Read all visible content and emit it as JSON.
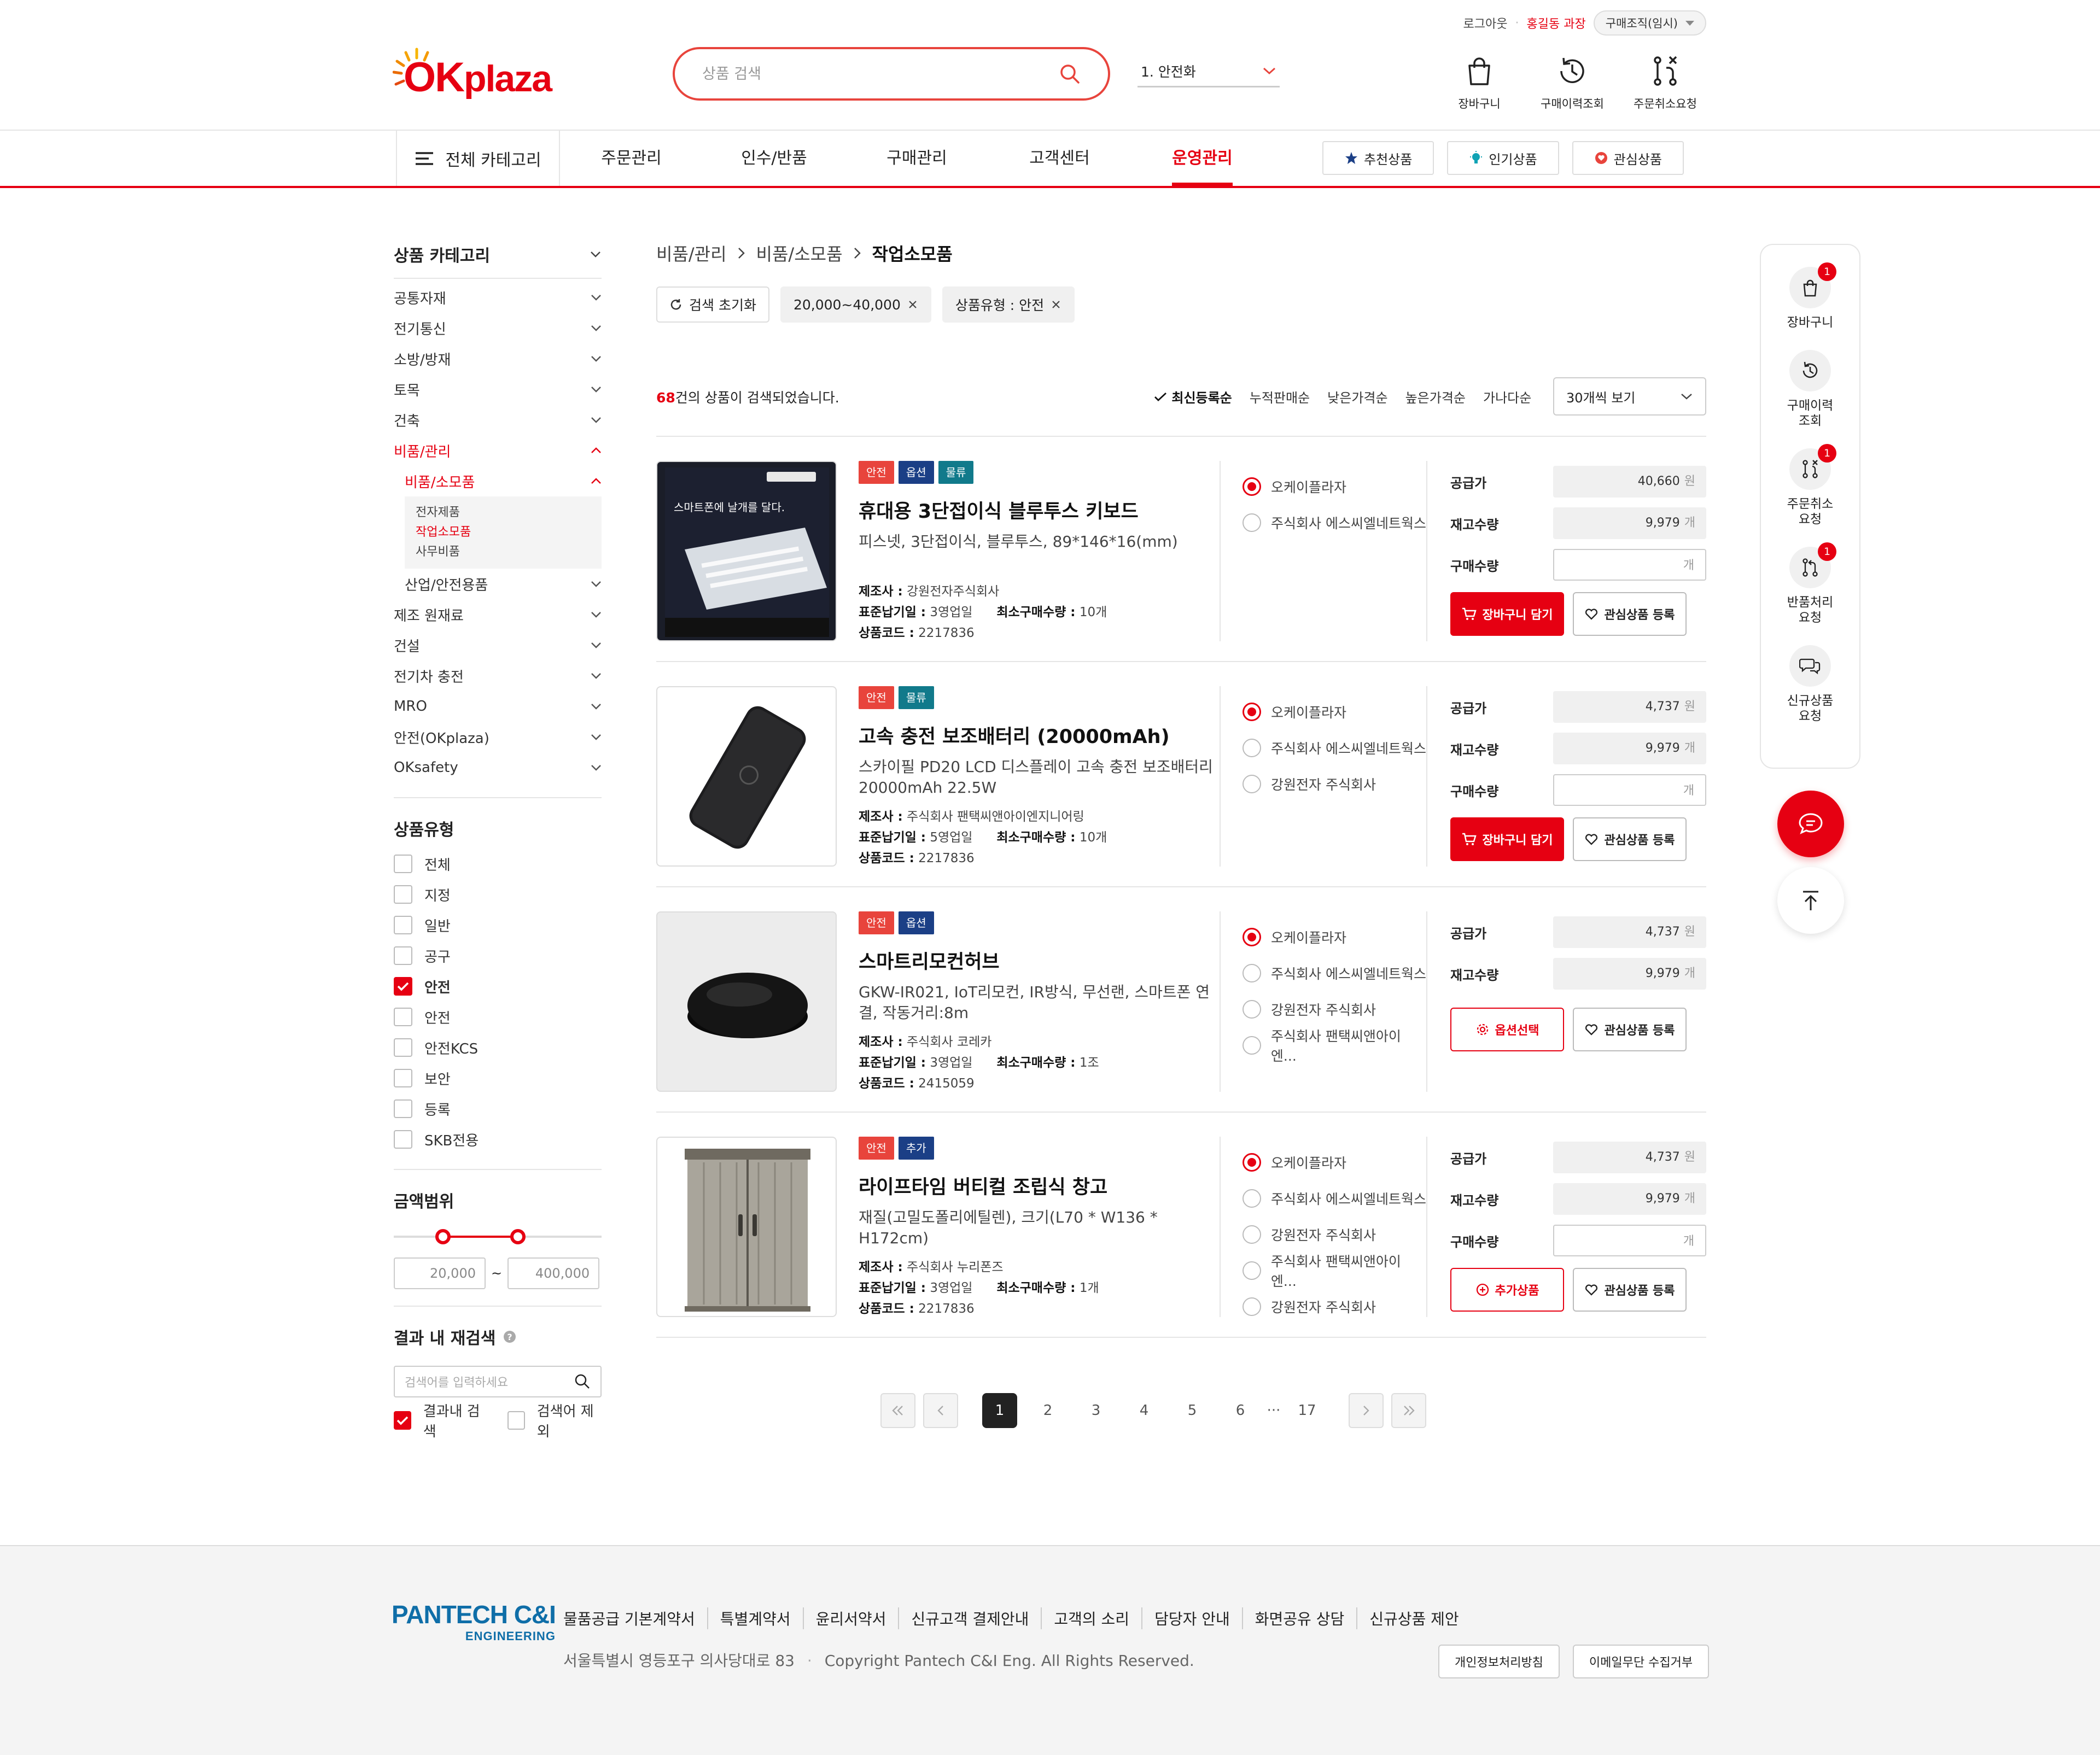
{
  "util": {
    "logout": "로그아웃",
    "user": "홍길동 과장",
    "org": "구매조직(임시)"
  },
  "logo": {
    "ok": "OK",
    "plaza": "plaza"
  },
  "search": {
    "placeholder": "상품 검색"
  },
  "category_select": "1. 안전화",
  "header_icons": [
    {
      "label": "장바구니",
      "icon": "shopping-bag-icon"
    },
    {
      "label": "구매이력조회",
      "icon": "history-icon"
    },
    {
      "label": "주문취소요청",
      "icon": "order-cancel-icon"
    }
  ],
  "gnb": {
    "all": "전체 카테고리",
    "items": [
      "주문관리",
      "인수/반품",
      "구매관리",
      "고객센터",
      "운영관리"
    ],
    "active": "운영관리",
    "buttons": [
      "추천상품",
      "인기상품",
      "관심상품"
    ]
  },
  "sidebar": {
    "category_title": "상품 카테고리",
    "categories": [
      "공통자재",
      "전기통신",
      "소방/방재",
      "토목",
      "건축",
      "비품/관리"
    ],
    "sub_active": "비품/소모품",
    "sub_items": [
      "전자제품",
      "작업소모품",
      "사무비품"
    ],
    "sub_item_active": "작업소모품",
    "sub_next": "산업/안전용품",
    "categories_after": [
      "제조 원재료",
      "건설",
      "전기차 충전",
      "MRO",
      "안전(OKplaza)",
      "OKsafety"
    ],
    "type_title": "상품유형",
    "types": [
      {
        "label": "전체",
        "checked": false
      },
      {
        "label": "지정",
        "checked": false
      },
      {
        "label": "일반",
        "checked": false
      },
      {
        "label": "공구",
        "checked": false
      },
      {
        "label": "안전",
        "checked": true
      },
      {
        "label": "안전",
        "checked": false
      },
      {
        "label": "안전KCS",
        "checked": false
      },
      {
        "label": "보안",
        "checked": false
      },
      {
        "label": "등록",
        "checked": false
      },
      {
        "label": "SKB전용",
        "checked": false
      }
    ],
    "price_title": "금액범위",
    "price_min": "20,000",
    "price_sep": "~",
    "price_max": "400,000",
    "research_title": "결과 내 재검색",
    "research_placeholder": "검색어를 입력하세요",
    "research_options": [
      {
        "label": "결과내 검색",
        "checked": true
      },
      {
        "label": "검색어 제외",
        "checked": false
      }
    ]
  },
  "breadcrumb": [
    "비품/관리",
    "비품/소모품",
    "작업소모품"
  ],
  "chips": [
    "검색 초기화",
    "20,000~40,000",
    "상품유형 : 안전"
  ],
  "result": {
    "count": "68",
    "text": "건의 상품이 검색되었습니다."
  },
  "sorts": [
    "최신등록순",
    "누적판매순",
    "낮은가격순",
    "높은가격순",
    "가나다순"
  ],
  "sort_active": "최신등록순",
  "per_page": "30개씩 보기",
  "labels": {
    "price": "공급가",
    "stock": "재고수량",
    "qty": "구매수량",
    "won": "원",
    "unit": "개",
    "maker": "제조사 :",
    "lead": "표준납기일 :",
    "minq": "최소구매수량 :",
    "code": "상품코드 :",
    "cart_btn": "장바구니 담기",
    "wish_btn": "관심상품 등록",
    "option_btn": "옵션선택",
    "add_btn": "추가상품"
  },
  "products": [
    {
      "tags": [
        "안전",
        "옵션",
        "물류"
      ],
      "name": "휴대용 3단접이식 블루투스 키보드",
      "desc": "피스넷, 3단접이식, 블루투스, 89*146*16(mm)",
      "maker": "강원전자주식회사",
      "lead": "3영업일",
      "minq": "10개",
      "code": "2217836",
      "vendors": [
        "오케이플라자",
        "주식회사 에스씨엘네트웍스"
      ],
      "price": "40,660",
      "stock": "9,979",
      "action": "cart",
      "img_text": "스마트폰에 날개를 달다."
    },
    {
      "tags": [
        "안전",
        "물류"
      ],
      "name": "고속 충전 보조배터리 (20000mAh)",
      "desc": "스카이필 PD20 LCD 디스플레이 고속 충전 보조배터리 20000mAh 22.5W",
      "maker": "주식회사 팬택씨앤아이엔지니어링",
      "lead": "5영업일",
      "minq": "10개",
      "code": "2217836",
      "vendors": [
        "오케이플라자",
        "주식회사 에스씨엘네트웍스",
        "강원전자 주식회사"
      ],
      "price": "4,737",
      "stock": "9,979",
      "action": "cart"
    },
    {
      "tags": [
        "안전",
        "옵션"
      ],
      "name": "스마트리모컨허브",
      "desc": "GKW-IR021, IoT리모컨, IR방식, 무선랜, 스마트폰 연결, 작동거리:8m",
      "maker": "주식회사 코레카",
      "lead": "3영업일",
      "minq": "1조",
      "code": "2415059",
      "vendors": [
        "오케이플라자",
        "주식회사 에스씨엘네트웍스",
        "강원전자 주식회사",
        "주식회사 팬택씨앤아이엔..."
      ],
      "price": "4,737",
      "stock": "9,979",
      "action": "option"
    },
    {
      "tags": [
        "안전",
        "추가"
      ],
      "name": "라이프타임 버티컬 조립식 창고",
      "desc": "재질(고밀도폴리에틸렌), 크기(L70 * W136 * H172cm)",
      "maker": "주식회사 누리폰즈",
      "lead": "3영업일",
      "minq": "1개",
      "code": "2217836",
      "vendors": [
        "오케이플라자",
        "주식회사 에스씨엘네트웍스",
        "강원전자 주식회사",
        "주식회사 팬택씨앤아이엔...",
        "강원전자 주식회사"
      ],
      "price": "4,737",
      "stock": "9,979",
      "action": "add"
    }
  ],
  "pagination": {
    "pages": [
      "1",
      "2",
      "3",
      "4",
      "5",
      "6"
    ],
    "ellipsis": "···",
    "last": "17",
    "current": "1"
  },
  "quick": [
    {
      "label": "장바구니",
      "badge": "1"
    },
    {
      "label": "구매이력 조회",
      "badge": ""
    },
    {
      "label": "주문취소 요청",
      "badge": "1"
    },
    {
      "label": "반품처리 요청",
      "badge": "1"
    },
    {
      "label": "신규상품 요청",
      "badge": ""
    }
  ],
  "footer": {
    "logo_main": "PANTECH C&I",
    "logo_sub": "ENGINEERING",
    "links": [
      "물품공급 기본계약서",
      "특별계약서",
      "윤리서약서",
      "신규고객 결제안내",
      "고객의 소리",
      "담당자 안내",
      "화면공유 상담",
      "신규상품 제안"
    ],
    "address": "서울특별시 영등포구 의사당대로 83",
    "copyright": "Copyright Pantech C&I Eng. All Rights Reserved.",
    "buttons": [
      "개인정보처리방침",
      "이메일무단 수집거부"
    ]
  },
  "colors": {
    "brand": "#e60012",
    "tag_red": "#e8443c",
    "tag_navy": "#1b3f86",
    "tag_teal": "#117a8b"
  }
}
